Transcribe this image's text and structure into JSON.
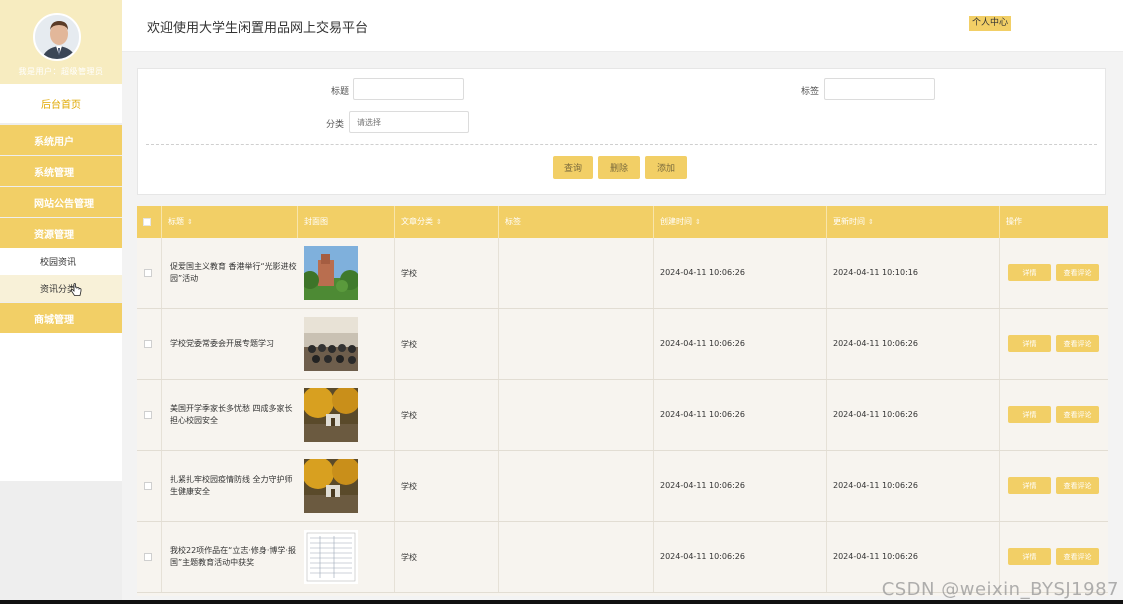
{
  "sidebar": {
    "user_text": "我是用户：超级管理员",
    "home": "后台首页",
    "items": [
      {
        "label": "系统用户"
      },
      {
        "label": "系统管理"
      },
      {
        "label": "网站公告管理"
      },
      {
        "label": "资源管理"
      }
    ],
    "subitems": [
      {
        "label": "校园资讯"
      },
      {
        "label": "资讯分类"
      }
    ],
    "last_item": "商城管理"
  },
  "header": {
    "title": "欢迎使用大学生闲置用品网上交易平台",
    "personal_center": "个人中心"
  },
  "search": {
    "title_label": "标题",
    "tag_label": "标签",
    "category_label": "分类",
    "category_placeholder": "请选择",
    "query_btn": "查询",
    "delete_btn": "删除",
    "add_btn": "添加"
  },
  "table": {
    "columns": [
      "标题",
      "封面图",
      "文章分类",
      "标签",
      "创建时间",
      "更新时间",
      "操作"
    ],
    "detail_btn": "详情",
    "comment_btn": "查看评论",
    "rows": [
      {
        "title": "促爱国主义教育 香港举行“光影进校园”活动",
        "category": "学校",
        "created": "2024-04-11 10:06:26",
        "updated": "2024-04-11 10:10:16"
      },
      {
        "title": "学校党委常委会开展专题学习",
        "category": "学校",
        "created": "2024-04-11 10:06:26",
        "updated": "2024-04-11 10:06:26"
      },
      {
        "title": "美国开学季家长多忧愁 四成多家长担心校园安全",
        "category": "学校",
        "created": "2024-04-11 10:06:26",
        "updated": "2024-04-11 10:06:26"
      },
      {
        "title": "扎紧扎牢校园疫情防线 全力守护师生健康安全",
        "category": "学校",
        "created": "2024-04-11 10:06:26",
        "updated": "2024-04-11 10:06:26"
      },
      {
        "title": "我校22项作品在“立志·修身·博学·报国”主题教育活动中获奖",
        "category": "学校",
        "created": "2024-04-11 10:06:26",
        "updated": "2024-04-11 10:06:26"
      }
    ]
  },
  "watermark": "CSDN @weixin_BYSJ1987",
  "colors": {
    "accent": "#f2cf66",
    "accent_light": "#f7ecc0",
    "row_bg": "#f7f4ef"
  }
}
